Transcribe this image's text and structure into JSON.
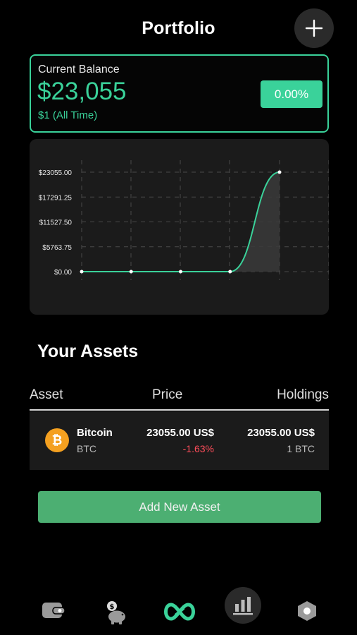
{
  "header": {
    "title": "Portfolio"
  },
  "balance": {
    "label": "Current Balance",
    "value": "$23,055",
    "all_time": "$1 (All Time)",
    "change_pct": "0.00%"
  },
  "chart_data": {
    "type": "area",
    "y_tick_labels": [
      "$23055.00",
      "$17291.25",
      "$11527.50",
      "$5763.75",
      "$0.00"
    ],
    "ylim": [
      0,
      23055
    ],
    "x": [
      0,
      1,
      2,
      3,
      4
    ],
    "values": [
      0,
      0,
      0,
      0,
      23055
    ],
    "grid": true,
    "line_color": "#3ad29a"
  },
  "assets": {
    "title": "Your Assets",
    "columns": {
      "asset": "Asset",
      "price": "Price",
      "holdings": "Holdings"
    },
    "rows": [
      {
        "name": "Bitcoin",
        "symbol": "BTC",
        "icon": "bitcoin-icon",
        "price": "23055.00 US$",
        "change": "-1.63%",
        "holding_value": "23055.00 US$",
        "holding_qty": "1 BTC"
      }
    ]
  },
  "add_asset_label": "Add New Asset",
  "nav": {
    "items": [
      "wallet-icon",
      "piggy-bank-icon",
      "infinity-logo-icon",
      "bar-chart-icon",
      "hexagon-settings-icon"
    ],
    "active": "bar-chart-icon"
  },
  "colors": {
    "accent": "#3ad29a",
    "negative": "#ff4d5a",
    "button": "#4caf72",
    "bitcoin": "#f4a020"
  }
}
